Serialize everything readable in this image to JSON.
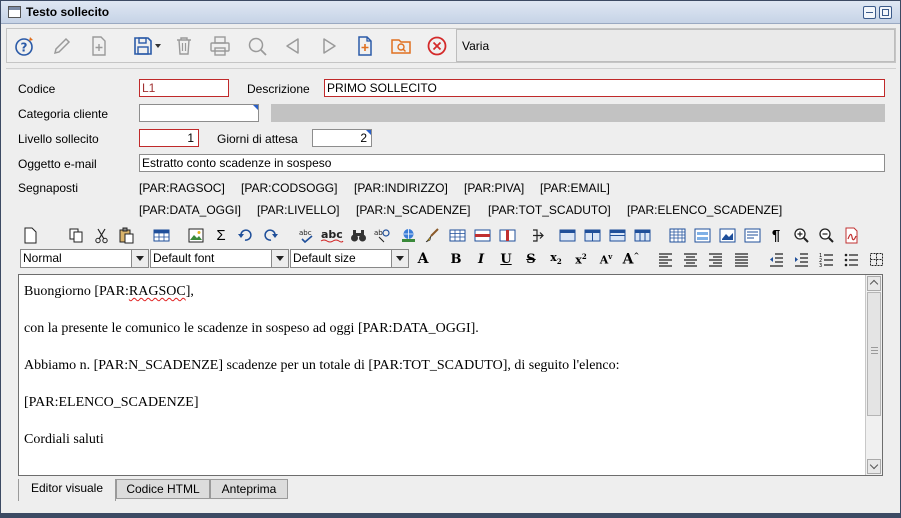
{
  "window": {
    "title": "Testo sollecito",
    "varia_label": "Varia"
  },
  "toolbar": {
    "items": [
      "help-icon",
      "edit-icon",
      "new-doc-icon",
      "save-icon",
      "delete-icon",
      "print-icon",
      "search-icon",
      "prev-icon",
      "next-icon",
      "add-doc-icon",
      "folder-search-icon",
      "close-icon"
    ]
  },
  "form": {
    "codice_label": "Codice",
    "codice_value": "L1",
    "descrizione_label": "Descrizione",
    "descrizione_value": "PRIMO SOLLECITO",
    "categoria_label": "Categoria cliente",
    "categoria_value": "",
    "categoria_desc": "",
    "livello_label": "Livello sollecito",
    "livello_value": "1",
    "giorni_label": "Giorni di attesa",
    "giorni_value": "2",
    "oggetto_label": "Oggetto e-mail",
    "oggetto_value": "Estratto conto scadenze in sospeso",
    "segnaposti_label": "Segnaposti",
    "placeholders_row1": [
      "[PAR:RAGSOC]",
      "[PAR:CODSOGG]",
      "[PAR:INDIRIZZO]",
      "[PAR:PIVA]",
      "[PAR:EMAIL]"
    ],
    "placeholders_row2": [
      "[PAR:DATA_OGGI]",
      "[PAR:LIVELLO]",
      "[PAR:N_SCADENZE]",
      "[PAR:TOT_SCADUTO]",
      "[PAR:ELENCO_SCADENZE]"
    ]
  },
  "format": {
    "style": "Normal",
    "font": "Default font",
    "size": "Default size"
  },
  "editor": {
    "line1_prefix": "Buongiorno [PAR:",
    "line1_spell": "RAGSOC",
    "line1_suffix": "],",
    "line2": "con la presente le comunico le scadenze in sospeso ad oggi [PAR:DATA_OGGI].",
    "line3": "Abbiamo n. [PAR:N_SCADENZE] scadenze per un totale di [PAR:TOT_SCADUTO], di seguito l'elenco:",
    "line4": "[PAR:ELENCO_SCADENZE]",
    "line5": "Cordiali saluti"
  },
  "tabs": {
    "visual": "Editor visuale",
    "html": "Codice HTML",
    "preview": "Anteprima"
  },
  "colors": {
    "required_border": "#c0292a",
    "accent_blue": "#2a60c8",
    "title_gradient_top": "#dfe7f3"
  }
}
